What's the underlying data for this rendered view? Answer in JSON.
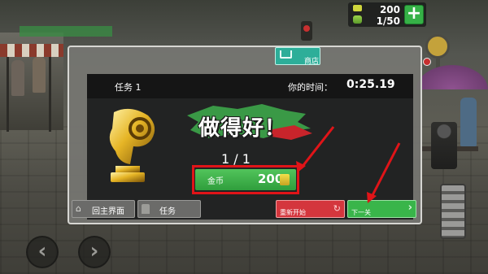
{
  "hud": {
    "coins": "200",
    "progress": "1/50",
    "add_icon": "plus-icon"
  },
  "dialog": {
    "shop_label": "商店",
    "mission_title": "任务 1",
    "time_label": "你的时间：",
    "time_value": "0:25.19",
    "headline": "做得好！",
    "count": "1 / 1",
    "reward_label": "金币",
    "reward_value": "200"
  },
  "buttons": {
    "main_menu": "回主界面",
    "mission": "任务",
    "restart": "重新开始",
    "next": "下一关"
  },
  "colors": {
    "accent_green": "#39b54a",
    "restart_red": "#d4363d",
    "shop_teal": "#2dae99",
    "annotation_red": "#e01418"
  }
}
